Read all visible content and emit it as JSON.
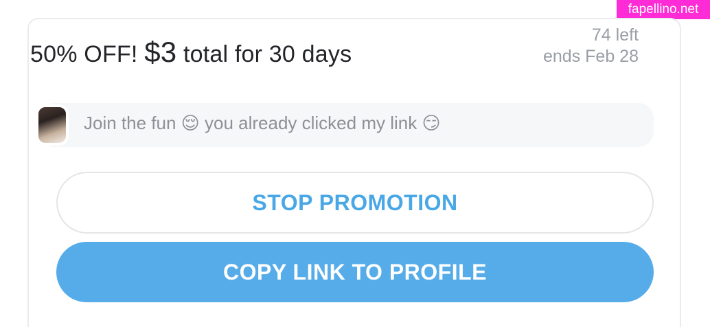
{
  "watermark": "fapellino.net",
  "promo": {
    "title_prefix": "50% OFF! ",
    "price": "$3",
    "title_suffix": " total for 30 days",
    "remaining": "74 left",
    "ends": "ends Feb 28"
  },
  "message": {
    "text": "Join the fun 😌 you already clicked my link 😏"
  },
  "buttons": {
    "stop": "STOP PROMOTION",
    "copy": "COPY LINK TO PROFILE"
  },
  "colors": {
    "accent": "#4aa7e6",
    "accent_fill": "#56ace9",
    "watermark_bg": "#ff2bd6"
  }
}
